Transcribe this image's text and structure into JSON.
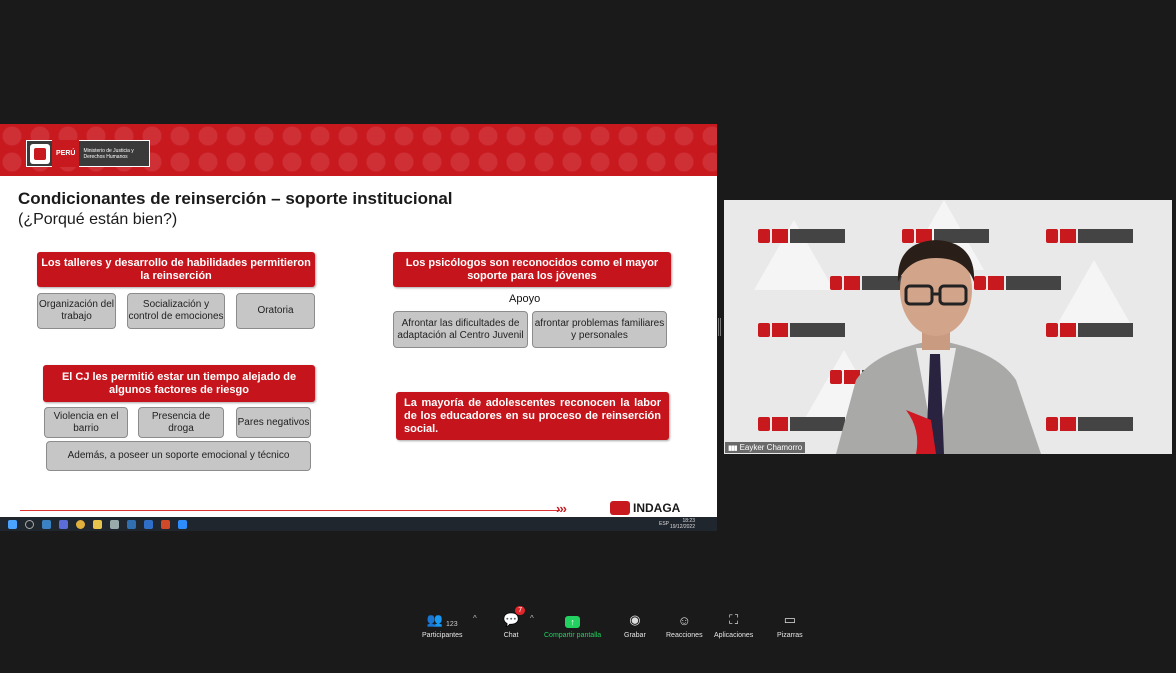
{
  "slide": {
    "logo": {
      "peru": "PERÚ",
      "ministry": "Ministerio de Justicia y Derechos Humanos"
    },
    "title": "Condicionantes de reinserción – soporte institucional",
    "subtitle": "(¿Porqué están bien?)",
    "box1": "Los talleres y desarrollo de habilidades permitieron la reinserción",
    "box1_items": [
      "Organización del trabajo",
      "Socialización y control de emociones",
      "Oratoria"
    ],
    "box2": "Los psicólogos son reconocidos como el mayor soporte para los jóvenes",
    "box2_label": "Apoyo",
    "box2_items": [
      "Afrontar las dificultades de adaptación al Centro Juvenil",
      "afrontar problemas familiares y personales"
    ],
    "box3": "El CJ les permitió estar un tiempo alejado de algunos factores de riesgo",
    "box3_items": [
      "Violencia en el barrio",
      "Presencia de droga",
      "Pares negativos"
    ],
    "box3_extra": "Además, a poseer un soporte emocional y técnico",
    "box4": "La mayoría de adolescentes reconocen la labor de los educadores en su proceso de reinserción social.",
    "footer_arrows": "›››",
    "footer_brand": "INDAGA",
    "taskbar": {
      "lang": "ESP",
      "time": "18:23",
      "date": "19/12/2022"
    }
  },
  "video": {
    "participant_name": "Eayker Chamorro",
    "signal_icon": "signal-bars-icon"
  },
  "toolbar": {
    "participants_label": "Participantes",
    "participants_count": "123",
    "chat_label": "Chat",
    "chat_badge": "7",
    "share_label": "Compartir pantalla",
    "record_label": "Grabar",
    "reactions_label": "Reacciones",
    "apps_label": "Aplicaciones",
    "whiteboard_label": "Pizarras"
  },
  "colors": {
    "accent_red": "#c5141b",
    "share_green": "#23d160",
    "background": "#1a1a1a"
  }
}
